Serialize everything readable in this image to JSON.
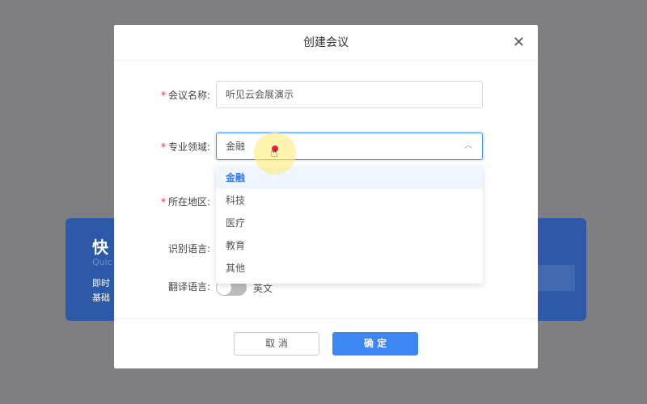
{
  "background_card": {
    "title": "快",
    "subtitle": "Quic",
    "line1": "即时",
    "line2": "基础"
  },
  "modal": {
    "title": "创建会议",
    "close_icon": "close-icon",
    "fields": {
      "name": {
        "label": "会议名称:",
        "required": true,
        "value": "听见云会展演示"
      },
      "domain": {
        "label": "专业领域:",
        "required": true,
        "value": "金融",
        "options": [
          "金融",
          "科技",
          "医疗",
          "教育",
          "其他"
        ],
        "selected": "金融"
      },
      "region": {
        "label": "所在地区:",
        "required": true
      },
      "recognition": {
        "label": "识别语言:"
      },
      "translation": {
        "label": "翻译语言:",
        "toggle_on": false,
        "value": "英文"
      }
    },
    "cancel_label": "取 消",
    "ok_label": "确 定"
  },
  "colors": {
    "primary": "#3c86f6",
    "required": "#f5222d"
  }
}
